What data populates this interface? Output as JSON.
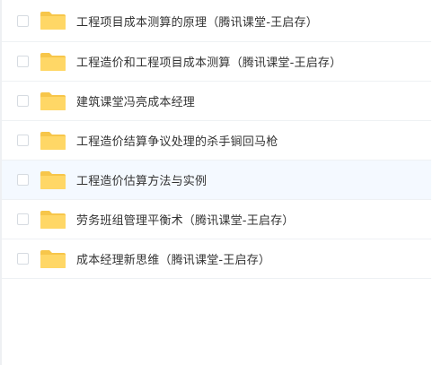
{
  "colors": {
    "folder": "#ffd766",
    "folder_tab": "#f7c64a",
    "hover_row": "#f4f9ff",
    "text": "#333333"
  },
  "file_list": {
    "items": [
      {
        "name": "工程项目成本测算的原理（腾讯课堂-王启存）",
        "icon": "folder-icon",
        "selected": false
      },
      {
        "name": "工程造价和工程项目成本测算（腾讯课堂-王启存）",
        "icon": "folder-icon",
        "selected": false
      },
      {
        "name": "建筑课堂冯亮成本经理",
        "icon": "folder-icon",
        "selected": false
      },
      {
        "name": "工程造价结算争议处理的杀手锏回马枪",
        "icon": "folder-icon",
        "selected": false
      },
      {
        "name": "工程造价估算方法与实例",
        "icon": "folder-icon",
        "selected": false,
        "hovered": true
      },
      {
        "name": "劳务班组管理平衡术（腾讯课堂-王启存）",
        "icon": "folder-icon",
        "selected": false
      },
      {
        "name": "成本经理新思维（腾讯课堂-王启存）",
        "icon": "folder-icon",
        "selected": false
      }
    ]
  }
}
